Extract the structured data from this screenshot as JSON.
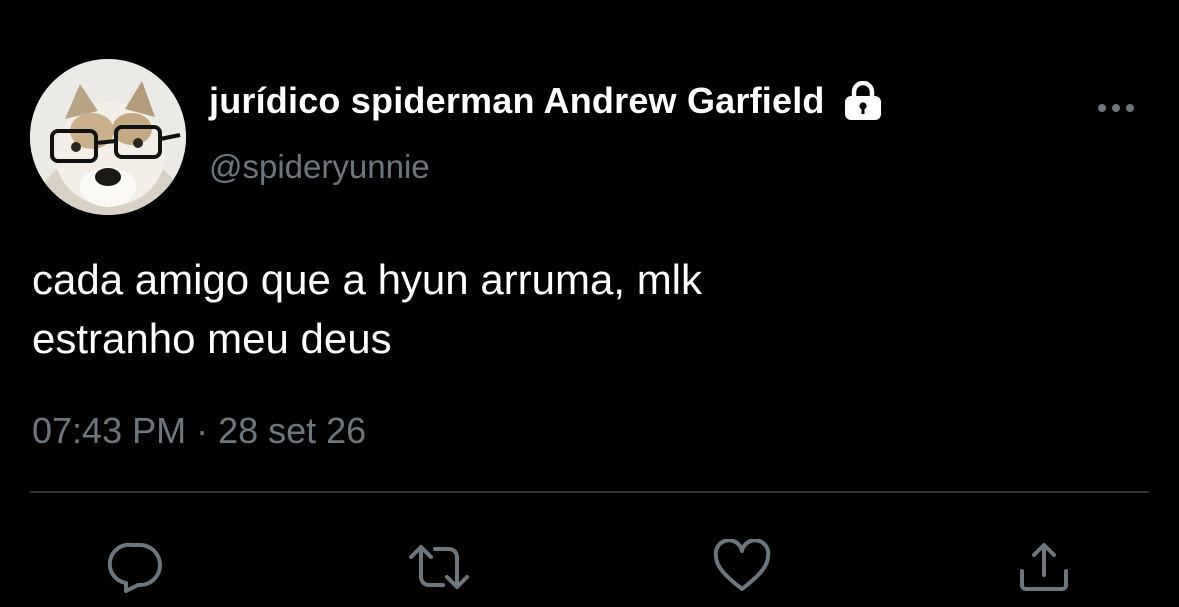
{
  "tweet": {
    "author": {
      "display_name": "jurídico spiderman Andrew Garfield",
      "handle": "@spideryunnie",
      "protected_icon": "lock-icon",
      "avatar_icon": "dog-with-glasses-avatar"
    },
    "text": "cada amigo que a hyun arruma, mlk\nestranho meu deus",
    "time": "07:43 PM",
    "separator": "·",
    "date": "28 set 26",
    "menu_icon": "more-horizontal-icon",
    "actions": [
      {
        "name": "reply",
        "icon": "reply-icon"
      },
      {
        "name": "retweet",
        "icon": "retweet-icon"
      },
      {
        "name": "like",
        "icon": "heart-icon"
      },
      {
        "name": "share",
        "icon": "share-icon"
      }
    ]
  },
  "colors": {
    "background": "#000000",
    "primary_text": "#ffffff",
    "secondary_text": "#6e767d",
    "divider": "#2f3336",
    "icon": "#6e767d"
  }
}
